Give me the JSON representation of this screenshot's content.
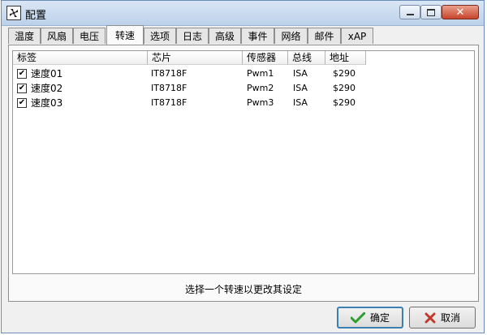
{
  "window": {
    "title": "配置"
  },
  "tabs": [
    {
      "label": "温度"
    },
    {
      "label": "风扇"
    },
    {
      "label": "电压"
    },
    {
      "label": "转速"
    },
    {
      "label": "选项"
    },
    {
      "label": "日志"
    },
    {
      "label": "高级"
    },
    {
      "label": "事件"
    },
    {
      "label": "网络"
    },
    {
      "label": "邮件"
    },
    {
      "label": "xAP"
    }
  ],
  "active_tab": "转速",
  "list": {
    "columns": [
      "标签",
      "芯片",
      "传感器",
      "总线",
      "地址"
    ],
    "rows": [
      {
        "checked": true,
        "label": "速度01",
        "chip": "IT8718F",
        "sensor": "Pwm1",
        "bus": "ISA",
        "address": "$290"
      },
      {
        "checked": true,
        "label": "速度02",
        "chip": "IT8718F",
        "sensor": "Pwm2",
        "bus": "ISA",
        "address": "$290"
      },
      {
        "checked": true,
        "label": "速度03",
        "chip": "IT8718F",
        "sensor": "Pwm3",
        "bus": "ISA",
        "address": "$290"
      }
    ]
  },
  "hint": "选择一个转速以更改其设定",
  "buttons": {
    "ok": "确定",
    "cancel": "取消"
  },
  "icons": {
    "app": "fan-icon",
    "minimize": "minimize-icon",
    "maximize": "maximize-icon",
    "close": "close-icon",
    "ok": "checkmark-icon",
    "cancel": "x-icon",
    "checkbox": "checkmark-icon"
  },
  "colors": {
    "ok_check": "#2e9e2e",
    "cancel_x": "#c0392b",
    "title_bar": "#bcd1ea"
  }
}
